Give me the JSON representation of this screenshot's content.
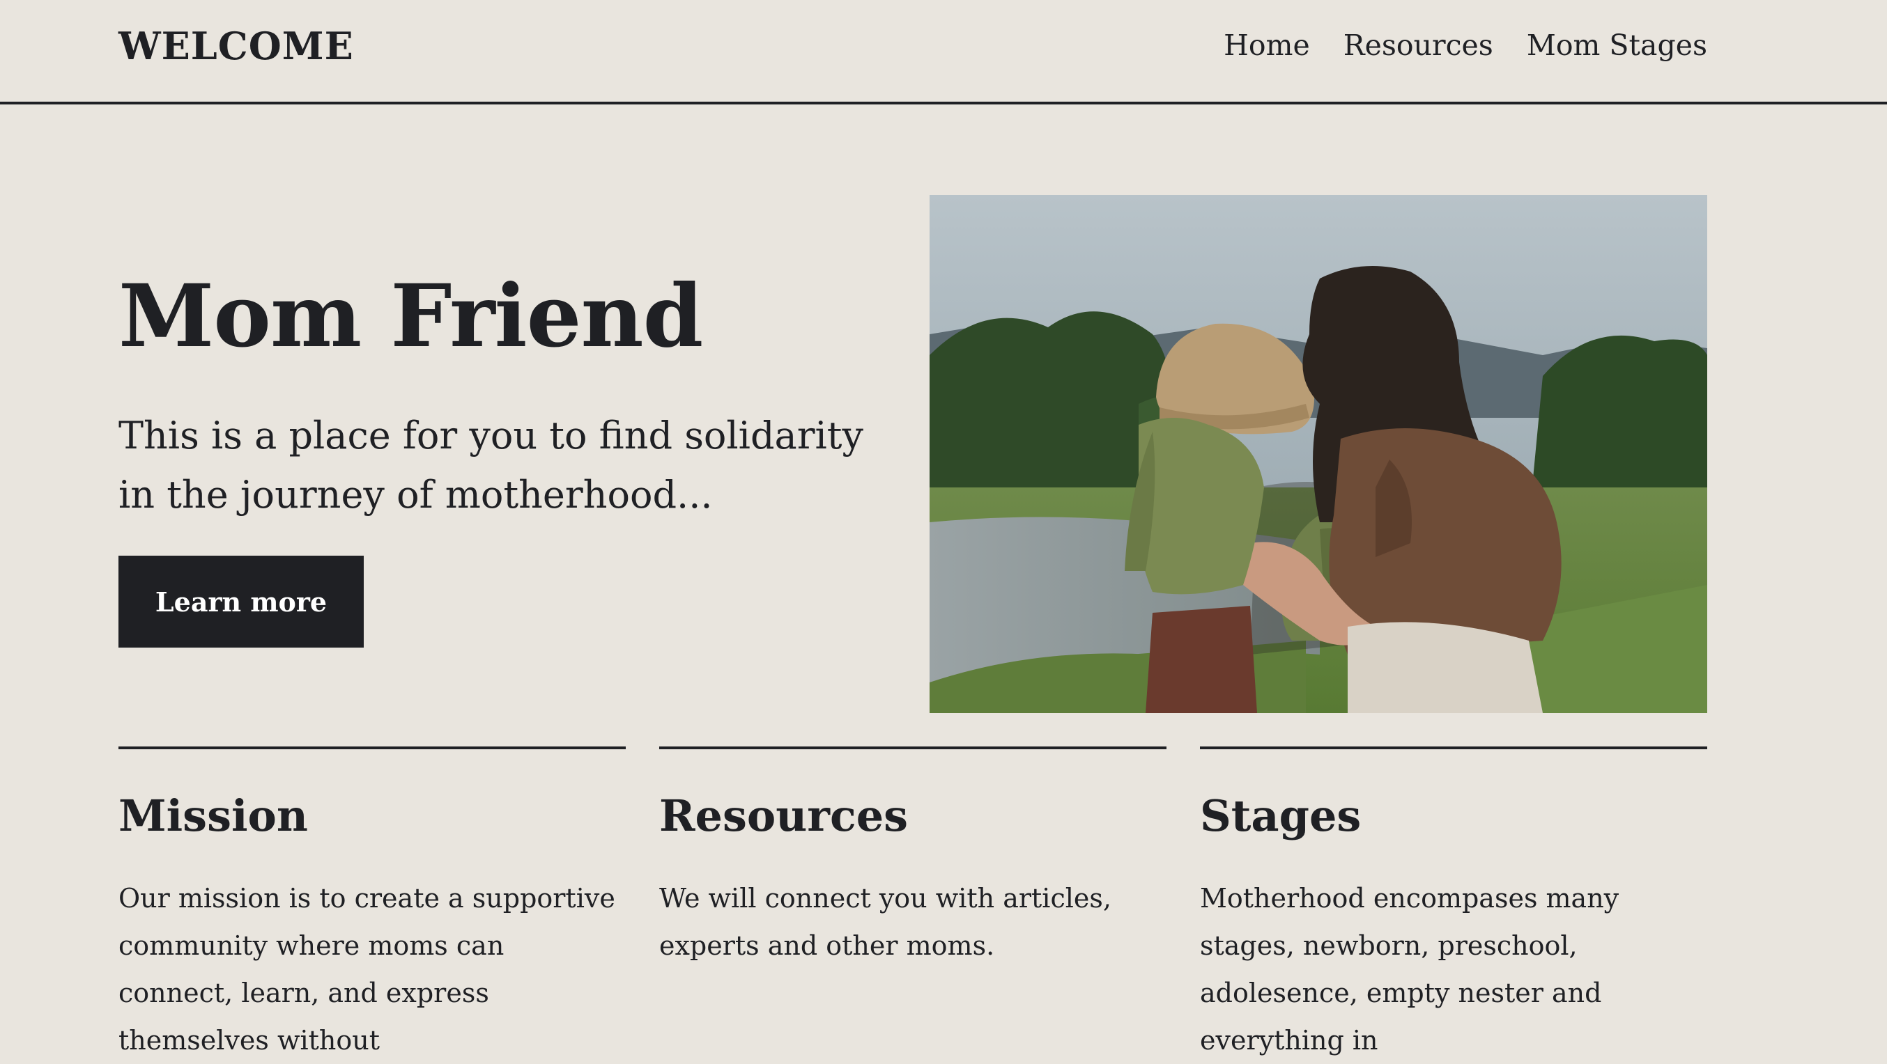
{
  "header": {
    "brand": "WELCOME",
    "nav": [
      "Home",
      "Resources",
      "Mom Stages"
    ]
  },
  "hero": {
    "title": "Mom Friend",
    "subtitle": "This is a place for you to find solidarity in the journey of motherhood...",
    "cta_label": "Learn more",
    "image": "photo-mother-kissing-child-outdoors"
  },
  "columns": [
    {
      "heading": "Mission",
      "text": "Our mission is to create a supportive community where moms can connect, learn, and express themselves without"
    },
    {
      "heading": "Resources",
      "text": "We will connect you with articles, experts and other moms."
    },
    {
      "heading": "Stages",
      "text": "Motherhood encompases many stages, newborn, preschool, adolesence, empty nester and everything in"
    }
  ],
  "colors": {
    "background": "#e9e5de",
    "text": "#1f2024",
    "button": "#1f2024",
    "button_text": "#ffffff"
  }
}
